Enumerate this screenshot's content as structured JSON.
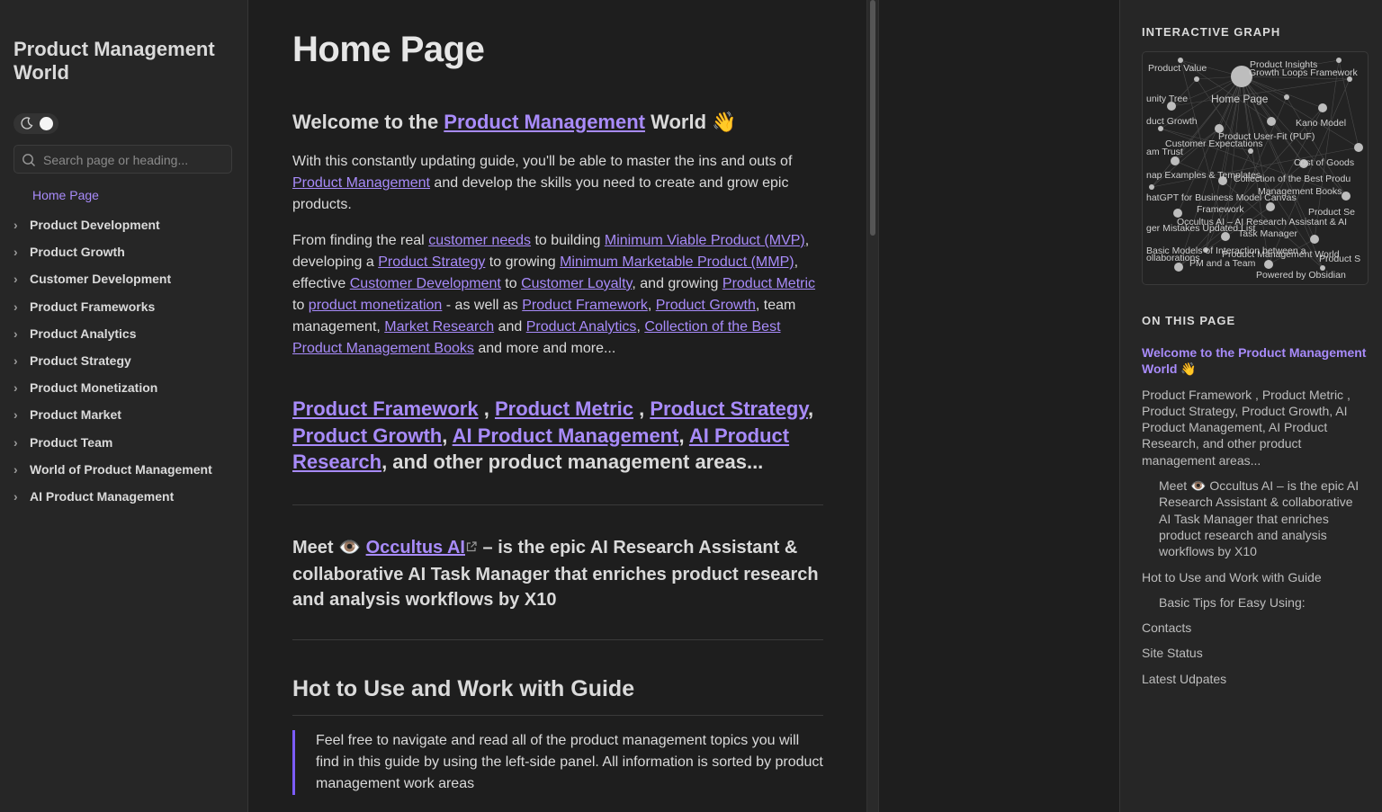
{
  "sidebar": {
    "site_title": "Product Management World",
    "search_placeholder": "Search page or heading...",
    "home": "Home Page",
    "items": [
      "Product Development",
      "Product Growth",
      "Customer Development",
      "Product Frameworks",
      "Product Analytics",
      "Product Strategy",
      "Product Monetization",
      "Product Market",
      "Product Team",
      "World of Product Management",
      "AI Product Management"
    ]
  },
  "main": {
    "title": "Home Page",
    "welcome": {
      "pre": "Welcome to the ",
      "link": "Product Management",
      "post": " World 👋"
    },
    "p1": {
      "t1": "With this constantly updating guide, you'll be able to master the ins and outs of ",
      "l1": "Product Management",
      "t2": " and develop the skills you need to create and grow epic products."
    },
    "p2": {
      "t1": "From finding the real ",
      "l1": "customer needs",
      "t2": " to building ",
      "l2": "Minimum Viable Product (MVP)",
      "t3": ", developing a ",
      "l3": "Product Strategy",
      "t4": " to growing ",
      "l4": "Minimum Marketable Product (MMP)",
      "t5": ", effective ",
      "l5": "Customer Development",
      "t6": " to ",
      "l6": "Customer Loyalty",
      "t7": ", and growing ",
      "l7": "Product Metric",
      "t8": " to ",
      "l8": "product monetization",
      "t9": " - as well as ",
      "l9": "Product Framework",
      "t10": ", ",
      "l10": "Product Growth",
      "t11": ", team management, ",
      "l11": "Market Research",
      "t12": " and ",
      "l12": "Product Analytics",
      "t13": ", ",
      "l13": "Collection of the Best Product Management Books",
      "t14": " and more and more..."
    },
    "areas": {
      "l1": "Product Framework",
      "s1": " , ",
      "l2": "Product Metric",
      "s2": " , ",
      "l3": "Product Strategy",
      "s3": ", ",
      "l4": "Product Growth",
      "s4": ", ",
      "l5": "AI Product Management",
      "s5": ", ",
      "l6": "AI Product Research",
      "tail": ", and other product management areas..."
    },
    "meet": {
      "pre": "Meet 👁️ ",
      "link": "Occultus AI",
      "post": " – is the epic AI Research Assistant & collaborative AI Task Manager that enriches product research and analysis workflows by X10"
    },
    "guide_title": "Hot to Use and Work with Guide",
    "quote": "Feel free to navigate and read all of the product management topics you will find in this guide by using the left-side panel. All information is sorted by product management work areas"
  },
  "right": {
    "graph_title": "INTERACTIVE GRAPH",
    "toc_title": "ON THIS PAGE",
    "toc": {
      "welcome": "Welcome to the Product Management World 👋",
      "areas": "Product Framework , Product Metric , Product Strategy, Product Growth, AI Product Management, AI Product Research, and other product management areas...",
      "meet": "Meet 👁️ Occultus AI – is the epic AI Research Assistant & collaborative AI Task Manager that enriches product research and analysis workflows by X10",
      "guide": "Hot to Use and Work with Guide",
      "tips": "Basic Tips for Easy Using:",
      "contacts": "Contacts",
      "status": "Site Status",
      "updates": "Latest Udpates"
    },
    "graph_labels": [
      "Product Value",
      "Product Insights",
      "Growth Loops Framework",
      "Home Page",
      "unity Tree",
      "duct Growth",
      "Kano Model",
      "Product User-Fit (PUF)",
      "Customer Expectations",
      "am Trust",
      "Cost of Goods",
      "nap Examples & Templates",
      "Collection of the Best Produ",
      "hatGPT for Business Model Canvas",
      "Management Books",
      "Framework",
      "Product Se",
      "Occultus AI – AI Research Assistant & AI",
      "ger Mistakes Updated List",
      "Task Manager",
      "Basic Models of Interaction between a",
      "Product Management World",
      "ollaborations",
      "PM and a Team",
      "Product S",
      "Powered by Obsidian"
    ]
  },
  "colors": {
    "accent": "#a88bfa",
    "bg": "#1e1e1e",
    "panel": "#262626",
    "quote_border": "#7c5cff"
  }
}
